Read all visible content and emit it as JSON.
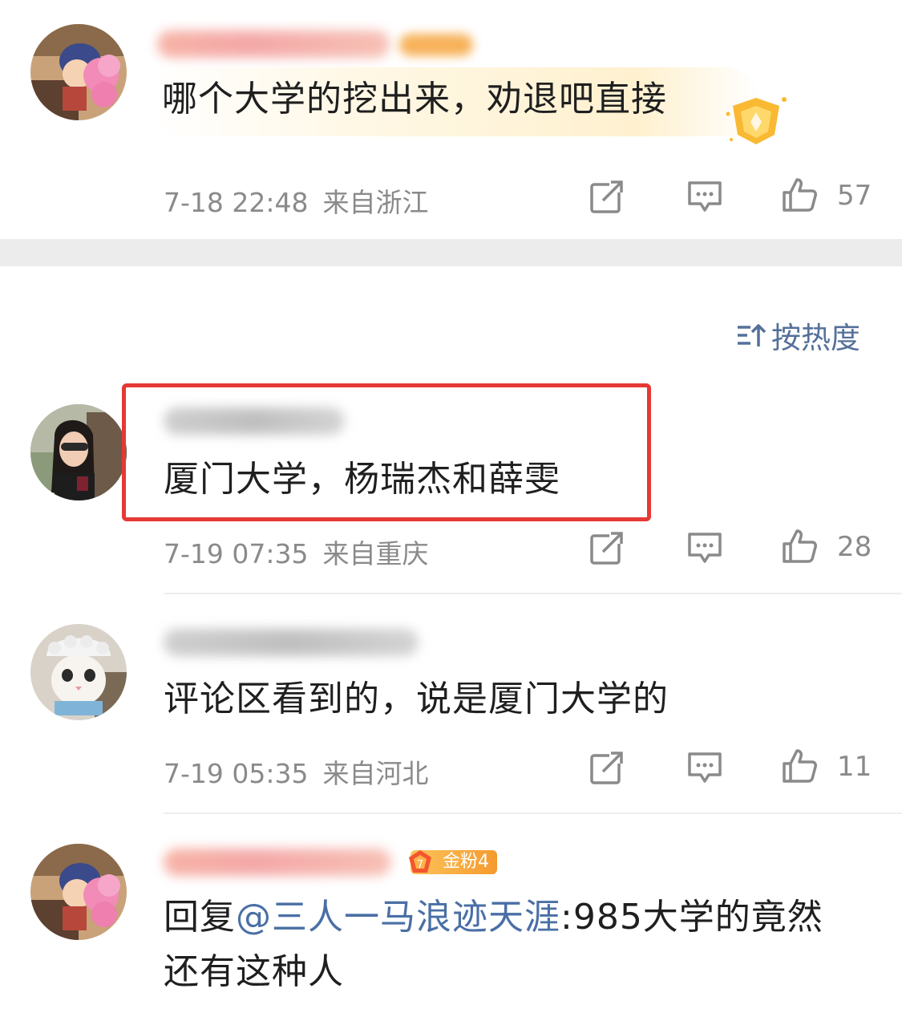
{
  "sort": {
    "label": "按热度"
  },
  "comments": [
    {
      "text": "哪个大学的挖出来，劝退吧直接",
      "time": "7-18 22:48",
      "location": "来自浙江",
      "likes": "57",
      "avatar_icon": "cartoon-boy-avatar"
    },
    {
      "text": "厦门大学，杨瑞杰和薛雯",
      "time": "7-19 07:35",
      "location": "来自重庆",
      "likes": "28",
      "avatar_icon": "woman-photo-avatar",
      "highlighted": true
    },
    {
      "text": "评论区看到的，说是厦门大学的",
      "time": "7-19 05:35",
      "location": "来自河北",
      "likes": "11",
      "avatar_icon": "cat-photo-avatar"
    },
    {
      "reply_prefix": "回复",
      "mention": "@三人一马浪迹天涯",
      "text_line1": ":985大学的竟然",
      "text_line2": "还有这种人",
      "badge": "金粉4",
      "badge_level": "7",
      "avatar_icon": "cartoon-boy-avatar"
    }
  ],
  "colors": {
    "accent_link": "#4a6fa5",
    "highlight_border": "#e53935",
    "meta_text": "#8a8a8a",
    "badge_orange": "#f59a2f"
  }
}
